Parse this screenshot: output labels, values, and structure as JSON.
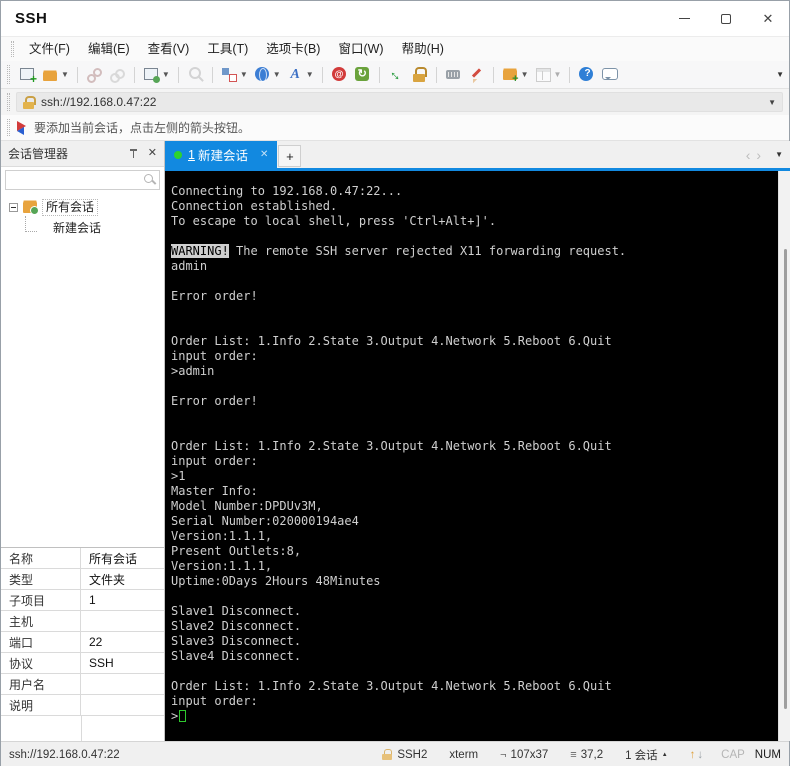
{
  "window": {
    "title": "SSH"
  },
  "menu_bar": {
    "items": [
      "文件(F)",
      "编辑(E)",
      "查看(V)",
      "工具(T)",
      "选项卡(B)",
      "窗口(W)",
      "帮助(H)"
    ]
  },
  "toolbar": {
    "buttons": [
      {
        "name": "new-session-icon",
        "dropdown": false,
        "group": 1,
        "disabled": false
      },
      {
        "name": "open-folder-icon",
        "dropdown": true,
        "group": 1,
        "disabled": false
      },
      {
        "name": "disconnect-icon",
        "dropdown": false,
        "group": 2,
        "disabled": true
      },
      {
        "name": "reconnect-icon",
        "dropdown": false,
        "group": 2,
        "disabled": true
      },
      {
        "name": "session-properties-icon",
        "dropdown": true,
        "group": 3,
        "disabled": false
      },
      {
        "name": "find-icon",
        "dropdown": false,
        "group": 4,
        "disabled": true
      },
      {
        "name": "layout-icon",
        "dropdown": true,
        "group": 5,
        "disabled": false
      },
      {
        "name": "web-icon",
        "dropdown": true,
        "group": 5,
        "disabled": false
      },
      {
        "name": "font-icon",
        "dropdown": true,
        "group": 5,
        "disabled": false
      },
      {
        "name": "record-icon",
        "dropdown": false,
        "group": 6,
        "disabled": false
      },
      {
        "name": "refresh-icon",
        "dropdown": false,
        "group": 6,
        "disabled": false
      },
      {
        "name": "fullscreen-icon",
        "dropdown": false,
        "group": 7,
        "disabled": false
      },
      {
        "name": "lock-icon",
        "dropdown": false,
        "group": 7,
        "disabled": false
      },
      {
        "name": "keyboard-icon",
        "dropdown": false,
        "group": 8,
        "disabled": false
      },
      {
        "name": "highlighter-icon",
        "dropdown": false,
        "group": 8,
        "disabled": false
      },
      {
        "name": "new-folder-icon",
        "dropdown": true,
        "group": 9,
        "disabled": false
      },
      {
        "name": "grid-icon",
        "dropdown": true,
        "group": 9,
        "disabled": true
      },
      {
        "name": "help-icon",
        "dropdown": false,
        "group": 10,
        "disabled": false
      },
      {
        "name": "message-icon",
        "dropdown": false,
        "group": 10,
        "disabled": false
      }
    ]
  },
  "address_bar": {
    "url": "ssh://192.168.0.47:22"
  },
  "info_bar": {
    "text": "要添加当前会话，点击左侧的箭头按钮。"
  },
  "session_manager": {
    "title": "会话管理器",
    "search_placeholder": "",
    "tree": {
      "root": "所有会话",
      "child": "新建会话"
    }
  },
  "tabs": {
    "active": {
      "number": "1",
      "label": "新建会话",
      "close": "✕"
    },
    "new_tab_label": "+"
  },
  "terminal": {
    "colors": {
      "background": "#000000",
      "foreground": "#cfcfcf",
      "cursor": "#2ec82e"
    },
    "lines": [
      {
        "text": "Connecting to 192.168.0.47:22..."
      },
      {
        "text": "Connection established."
      },
      {
        "text": "To escape to local shell, press 'Ctrl+Alt+]'."
      },
      {
        "text": ""
      },
      {
        "invert": "WARNING!",
        "text": " The remote SSH server rejected X11 forwarding request."
      },
      {
        "text": "admin"
      },
      {
        "text": ""
      },
      {
        "text": "Error order!"
      },
      {
        "text": ""
      },
      {
        "text": ""
      },
      {
        "text": "Order List: 1.Info 2.State 3.Output 4.Network 5.Reboot 6.Quit"
      },
      {
        "text": "input order:"
      },
      {
        "text": ">admin"
      },
      {
        "text": ""
      },
      {
        "text": "Error order!"
      },
      {
        "text": ""
      },
      {
        "text": ""
      },
      {
        "text": "Order List: 1.Info 2.State 3.Output 4.Network 5.Reboot 6.Quit"
      },
      {
        "text": "input order:"
      },
      {
        "text": ">1"
      },
      {
        "text": "Master Info:"
      },
      {
        "text": "Model Number:DPDUv3M,"
      },
      {
        "text": "Serial Number:020000194ae4"
      },
      {
        "text": "Version:1.1.1,"
      },
      {
        "text": "Present Outlets:8,"
      },
      {
        "text": "Version:1.1.1,"
      },
      {
        "text": "Uptime:0Days 2Hours 48Minutes"
      },
      {
        "text": ""
      },
      {
        "text": "Slave1 Disconnect."
      },
      {
        "text": "Slave2 Disconnect."
      },
      {
        "text": "Slave3 Disconnect."
      },
      {
        "text": "Slave4 Disconnect."
      },
      {
        "text": ""
      },
      {
        "text": "Order List: 1.Info 2.State 3.Output 4.Network 5.Reboot 6.Quit"
      },
      {
        "text": "input order:"
      },
      {
        "text": ">",
        "cursor": true
      }
    ]
  },
  "properties": {
    "rows": [
      {
        "label": "名称",
        "value": "所有会话"
      },
      {
        "label": "类型",
        "value": "文件夹"
      },
      {
        "label": "子项目",
        "value": "1"
      },
      {
        "label": "主机",
        "value": ""
      },
      {
        "label": "端口",
        "value": "22"
      },
      {
        "label": "协议",
        "value": "SSH"
      },
      {
        "label": "用户名",
        "value": ""
      },
      {
        "label": "说明",
        "value": ""
      }
    ]
  },
  "status_bar": {
    "address": "ssh://192.168.0.47:22",
    "protocol": "SSH2",
    "terminal_type": "xterm",
    "terminal_size": "107x37",
    "cursor_position": "37,2",
    "session_count": "1 会话",
    "caps_indicator": "CAP",
    "num_indicator": "NUM"
  }
}
